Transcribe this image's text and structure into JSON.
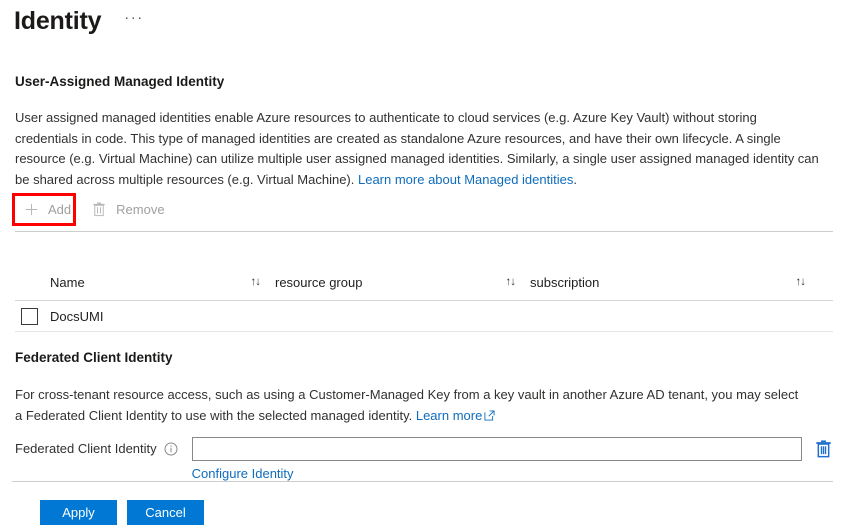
{
  "header": {
    "title": "Identity",
    "more_menu": "···"
  },
  "user_assigned": {
    "heading": "User-Assigned Managed Identity",
    "description_part1": "User assigned managed identities enable Azure resources to authenticate to cloud services (e.g. Azure Key Vault) without storing credentials in code. This type of managed identities are created as standalone Azure resources, and have their own lifecycle. A single resource (e.g. Virtual Machine) can utilize multiple user assigned managed identities. Similarly, a single user assigned managed identity can be shared across multiple resources (e.g. Virtual Machine). ",
    "learn_more_link": "Learn more about Managed identities",
    "description_part2": "."
  },
  "toolbar": {
    "add_label": "Add",
    "add_icon": "plus-icon",
    "remove_label": "Remove",
    "remove_icon": "trash-icon"
  },
  "table": {
    "columns": [
      {
        "label": "Name",
        "sort_icon": "↑↓"
      },
      {
        "label": "resource group",
        "sort_icon": "↑↓"
      },
      {
        "label": "subscription",
        "sort_icon": "↑↓"
      }
    ],
    "rows": [
      {
        "selected": false,
        "name": "DocsUMI",
        "resource_group": "",
        "subscription": ""
      }
    ]
  },
  "federated": {
    "heading": "Federated Client Identity",
    "description_part1": "For cross-tenant resource access, such as using a Customer-Managed Key from a key vault in another Azure AD tenant, you may select a Federated Client Identity to use with the selected managed identity. ",
    "learn_more_link": "Learn more",
    "field_label": "Federated Client Identity",
    "field_value": "",
    "field_placeholder": "",
    "info_icon": "info-icon",
    "configure_link": "Configure Identity",
    "delete_icon": "trash-icon"
  },
  "footer": {
    "apply_label": "Apply",
    "cancel_label": "Cancel"
  },
  "colors": {
    "accent_blue": "#0078d4",
    "link_blue": "#0f6cbd",
    "highlight_red": "#ff0000",
    "disabled_gray": "#a19f9d"
  }
}
